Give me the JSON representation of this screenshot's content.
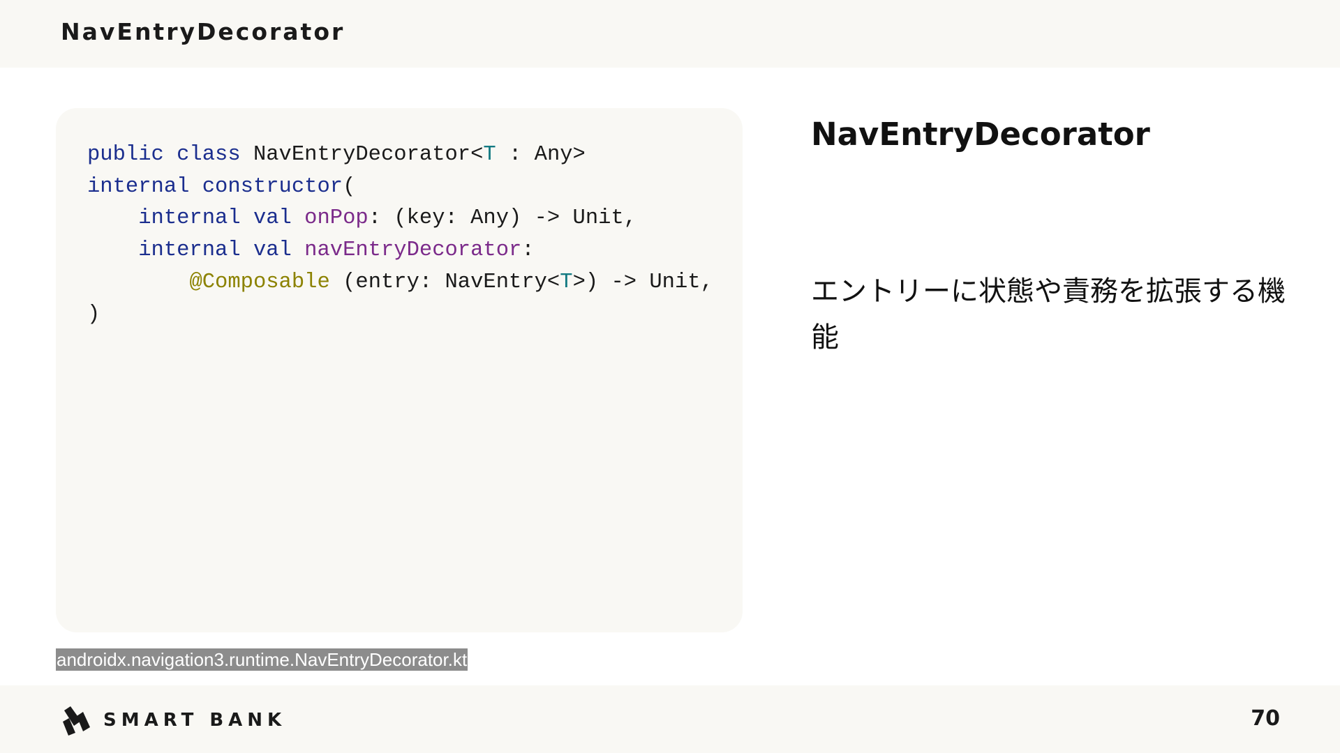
{
  "header": {
    "title": "NavEntryDecorator"
  },
  "code": {
    "lines": [
      [
        {
          "t": "public class ",
          "c": "kw"
        },
        {
          "t": "NavEntryDecorator<",
          "c": ""
        },
        {
          "t": "T",
          "c": "tp"
        },
        {
          "t": " : Any>",
          "c": ""
        }
      ],
      [
        {
          "t": "internal constructor",
          "c": "kw"
        },
        {
          "t": "(",
          "c": ""
        }
      ],
      [
        {
          "t": "    ",
          "c": ""
        },
        {
          "t": "internal val ",
          "c": "kw"
        },
        {
          "t": "onPop",
          "c": "prop"
        },
        {
          "t": ": (key: Any) -> Unit,",
          "c": ""
        }
      ],
      [
        {
          "t": "    ",
          "c": ""
        },
        {
          "t": "internal val ",
          "c": "kw"
        },
        {
          "t": "navEntryDecorator",
          "c": "prop"
        },
        {
          "t": ":",
          "c": ""
        }
      ],
      [
        {
          "t": "        ",
          "c": ""
        },
        {
          "t": "@Composable",
          "c": "ann"
        },
        {
          "t": " (entry: NavEntry<",
          "c": ""
        },
        {
          "t": "T",
          "c": "tp"
        },
        {
          "t": ">) -> Unit,",
          "c": ""
        }
      ],
      [
        {
          "t": ")",
          "c": ""
        }
      ]
    ]
  },
  "source_caption": "androidx.navigation3.runtime.NavEntryDecorator.kt",
  "side": {
    "title": "NavEntryDecorator",
    "description": "エントリーに状態や責務を拡張する機能"
  },
  "footer": {
    "logo_icon": "smartbank-logo-icon",
    "logo_text": "SMART BANK",
    "page_number": "70"
  },
  "colors": {
    "keyword": "#1b2e8e",
    "type_param": "#137a82",
    "property": "#7b2a8a",
    "annotation": "#8c8200",
    "panel_bg": "#f9f8f4"
  }
}
